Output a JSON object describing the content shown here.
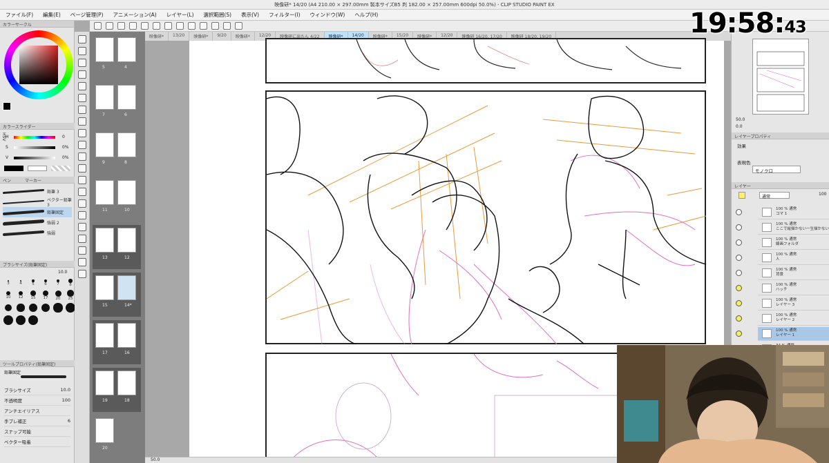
{
  "window": {
    "title": "映像研* 14/20 (A4 210.00 × 297.00mm 製本サイズB5 判 182.00 × 257.00mm 600dpi 50.0%) - CLIP STUDIO PAINT EX"
  },
  "menu": [
    "ファイル(F)",
    "編集(E)",
    "ページ管理(P)",
    "アニメーション(A)",
    "レイヤー(L)",
    "選択範囲(S)",
    "表示(V)",
    "フィルター(I)",
    "ウィンドウ(W)",
    "ヘルプ(H)"
  ],
  "tabs": [
    "映像研*",
    "13/20",
    "映像研*",
    "9/20",
    "映像研*",
    "12/20",
    "映像研に出たん 4/22",
    "映像研*",
    "14/20",
    "映像研*",
    "15/20",
    "映像研*",
    "12/20",
    "映像研 16/20, 17/20",
    "映像研 18/20, 19/20"
  ],
  "clock": {
    "main": "19:58:",
    "seconds": "43"
  },
  "color_panel": {
    "title": "カラーサークル",
    "slider_title": "カラースライダー",
    "model": "HSV",
    "sliders": [
      {
        "label": "H",
        "value": "0"
      },
      {
        "label": "S",
        "value": "0%"
      },
      {
        "label": "V",
        "value": "0%"
      }
    ]
  },
  "subtool": {
    "tab_pen": "ペン",
    "tab_marker": "マーカー",
    "brushes": [
      "鉛筆 3",
      "ベクター鉛筆 3",
      "鉛筆固定",
      "強弱 2",
      "強弱"
    ],
    "selected": 2
  },
  "brush_size": {
    "title": "ブラシサイズ(鉛筆固定)",
    "value": "10.0",
    "sizes": [
      "3",
      "4",
      "5",
      "6",
      "7",
      "8",
      "10",
      "12",
      "15",
      "17",
      "20",
      "25",
      "30",
      "40",
      "50",
      "60",
      "70",
      "80",
      "100",
      "120",
      "150"
    ]
  },
  "tool_property": {
    "title": "ツールプロパティ(鉛筆固定)",
    "name": "鉛筆固定",
    "rows": [
      {
        "label": "ブラシサイズ",
        "value": "10.0"
      },
      {
        "label": "不透明度",
        "value": "100"
      },
      {
        "label": "アンチエイリアス",
        "value": ""
      },
      {
        "label": "手ブレ補正",
        "value": "6"
      },
      {
        "label": "スナップ可能",
        "value": ""
      },
      {
        "label": "ベクター吸着",
        "value": ""
      }
    ]
  },
  "pages": [
    {
      "num": "5"
    },
    {
      "num": "4"
    },
    {
      "num": "7"
    },
    {
      "num": "6"
    },
    {
      "num": "9"
    },
    {
      "num": "8"
    },
    {
      "num": "11"
    },
    {
      "num": "10"
    },
    {
      "num": "13"
    },
    {
      "num": "12"
    },
    {
      "num": "15"
    },
    {
      "num": "14*"
    },
    {
      "num": "17"
    },
    {
      "num": "16"
    },
    {
      "num": "19"
    },
    {
      "num": "18"
    },
    {
      "num": "20"
    }
  ],
  "navigator": {
    "zoom": "50.0",
    "angle": "0.0"
  },
  "layer_property": {
    "title": "レイヤープロパティ",
    "effect": "効果",
    "expression_label": "表現色",
    "expression_value": "モノクロ"
  },
  "layers": {
    "title": "レイヤー",
    "blend": "通常",
    "opacity": "100",
    "items": [
      {
        "pct": "100 % 通常",
        "name": "コマ 1"
      },
      {
        "pct": "100 % 通常",
        "name": "ここで絵描かない一生描かない"
      },
      {
        "pct": "100 % 通常",
        "name": "線画フォルダ"
      },
      {
        "pct": "100 % 通常",
        "name": "人"
      },
      {
        "pct": "100 % 通常",
        "name": "背景"
      },
      {
        "pct": "100 % 通常",
        "name": "ハッチ"
      },
      {
        "pct": "100 % 通常",
        "name": "レイヤー 3"
      },
      {
        "pct": "100 % 通常",
        "name": "レイヤー 2"
      },
      {
        "pct": "100 % 通常",
        "name": "レイヤー 1"
      },
      {
        "pct": "34 % 通常",
        "name": "レイヤー 1のコピー 2"
      },
      {
        "pct": "48 % 通常",
        "name": "レイヤー 1のコピー"
      }
    ],
    "selected": 8
  },
  "status": {
    "zoom": "50.0"
  }
}
